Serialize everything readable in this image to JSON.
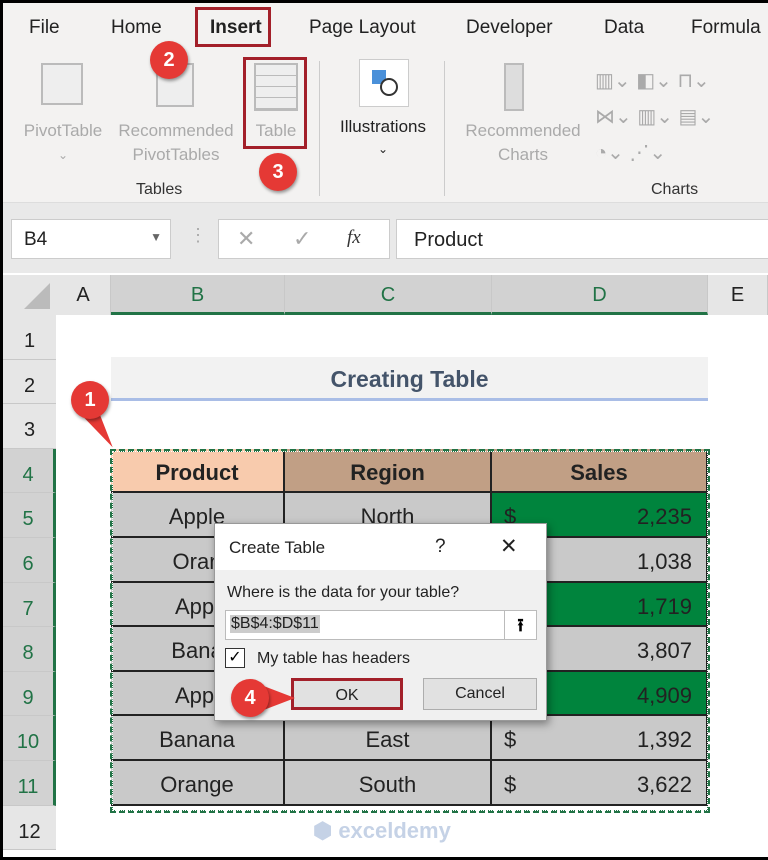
{
  "ribbon_tabs": [
    "File",
    "Home",
    "Insert",
    "Page Layout",
    "Developer",
    "Data",
    "Formula"
  ],
  "ribbon": {
    "pivottable": "PivotTable",
    "recommended_pivot_1": "Recommended",
    "recommended_pivot_2": "PivotTables",
    "table": "Table",
    "tables_group": "Tables",
    "illustrations": "Illustrations",
    "recommended_charts_1": "Recommended",
    "recommended_charts_2": "Charts",
    "charts_group": "Charts"
  },
  "formula_bar": {
    "name_box": "B4",
    "fx": "fx",
    "value": "Product"
  },
  "columns": [
    "A",
    "B",
    "C",
    "D",
    "E"
  ],
  "rows": [
    "1",
    "2",
    "3",
    "4",
    "5",
    "6",
    "7",
    "8",
    "9",
    "10",
    "11",
    "12"
  ],
  "sheet": {
    "title": "Creating Table",
    "headers": [
      "Product",
      "Region",
      "Sales"
    ],
    "data": [
      {
        "product": "Apple",
        "region": "North",
        "sales": "2,235",
        "dollar": "$"
      },
      {
        "product": "Oran",
        "region": "",
        "sales": "1,038",
        "dollar": ""
      },
      {
        "product": "Appl",
        "region": "",
        "sales": "1,719",
        "dollar": ""
      },
      {
        "product": "Bana",
        "region": "",
        "sales": "3,807",
        "dollar": ""
      },
      {
        "product": "Appl",
        "region": "",
        "sales": "4,909",
        "dollar": ""
      },
      {
        "product": "Banana",
        "region": "East",
        "sales": "1,392",
        "dollar": "$"
      },
      {
        "product": "Orange",
        "region": "South",
        "sales": "3,622",
        "dollar": "$"
      }
    ]
  },
  "dialog": {
    "title": "Create Table",
    "help": "?",
    "close": "✕",
    "prompt": "Where is the data for your table?",
    "range": "$B$4:$D$11",
    "checkbox_label": "My table has headers",
    "checked": true,
    "ok": "OK",
    "cancel": "Cancel"
  },
  "badges": [
    "1",
    "2",
    "3",
    "4"
  ],
  "watermark": "exceldemy EXCEL · DATA · BI",
  "colors": {
    "header_product": "#f8cbad",
    "header_other": "#c19f85",
    "green": "#00843d",
    "gray": "#c9c9c9",
    "accent": "#217346",
    "callout": "#e53935"
  }
}
